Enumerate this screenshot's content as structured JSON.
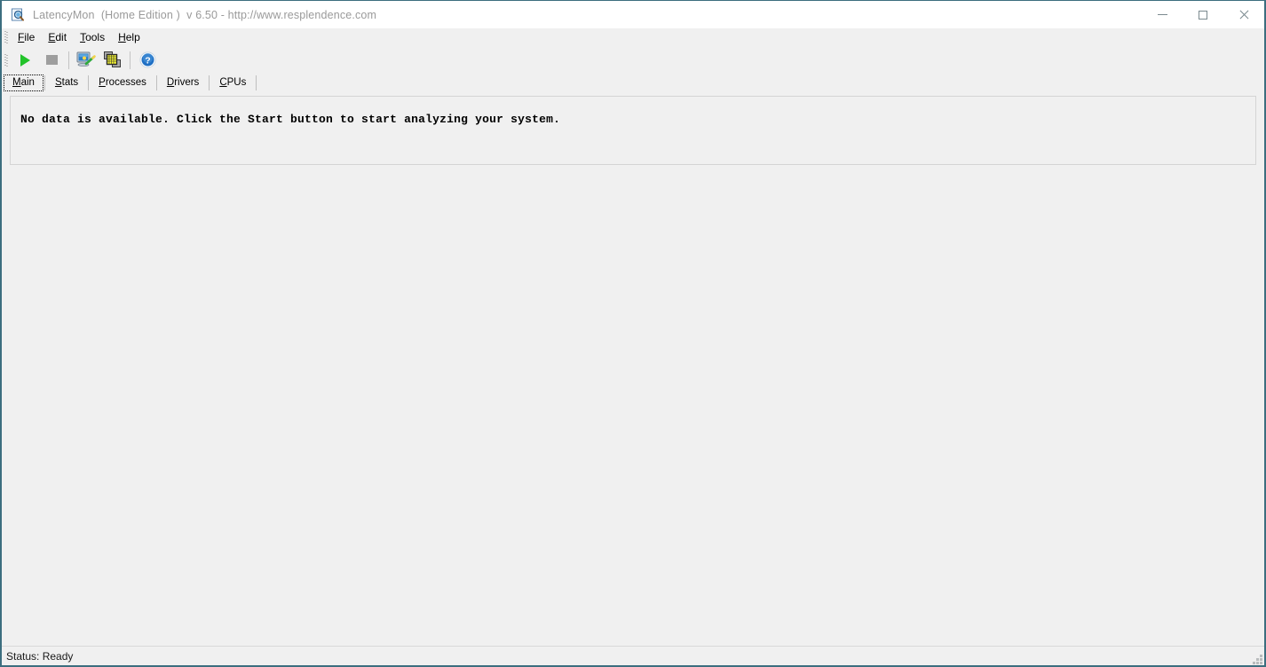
{
  "window": {
    "title": "LatencyMon  (Home Edition )  v 6.50 - http://www.resplendence.com",
    "app_icon": "document-magnifier-icon",
    "border_color": "#3c6e7f",
    "titlebar_text_color": "#9a9a9a",
    "controls": {
      "minimize": "minimize-icon",
      "maximize": "maximize-icon",
      "close": "close-icon"
    }
  },
  "menubar": {
    "items": [
      {
        "label": "File",
        "accel": "F"
      },
      {
        "label": "Edit",
        "accel": "E"
      },
      {
        "label": "Tools",
        "accel": "T"
      },
      {
        "label": "Help",
        "accel": "H"
      }
    ]
  },
  "toolbar": {
    "buttons": [
      {
        "name": "start-button",
        "icon": "play-icon",
        "enabled": true,
        "tooltip": "Start"
      },
      {
        "name": "stop-button",
        "icon": "stop-icon",
        "enabled": false,
        "tooltip": "Stop"
      },
      {
        "name": "report-button",
        "icon": "monitor-wand-icon",
        "enabled": true,
        "tooltip": "System Report"
      },
      {
        "name": "windows-button",
        "icon": "cascade-windows-icon",
        "enabled": true,
        "tooltip": "Windows"
      },
      {
        "name": "help-button",
        "icon": "help-circle-icon",
        "enabled": true,
        "tooltip": "Help"
      }
    ]
  },
  "tabs": {
    "selected": "Main",
    "items": [
      {
        "label": "Main",
        "accel": "M"
      },
      {
        "label": "Stats",
        "accel": "S"
      },
      {
        "label": "Processes",
        "accel": "P"
      },
      {
        "label": "Drivers",
        "accel": "D"
      },
      {
        "label": "CPUs",
        "accel": "C"
      }
    ]
  },
  "main": {
    "message": "No data is available. Click the Start button to start analyzing your system."
  },
  "statusbar": {
    "text": "Status: Ready"
  },
  "colors": {
    "window_border": "#3c6e7f",
    "chrome_bg": "#f0f0f0",
    "titlebar_bg": "#ffffff",
    "play_green": "#22c32a",
    "stop_gray": "#9e9e9e",
    "help_blue": "#1f6fc4",
    "windows_yellow": "#ffff33"
  }
}
